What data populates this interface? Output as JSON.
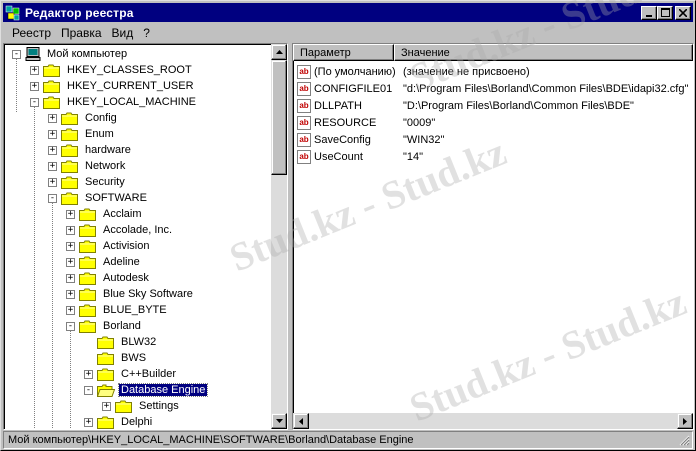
{
  "window": {
    "title": "Редактор реестра",
    "controls": [
      "minimize",
      "maximize",
      "close"
    ]
  },
  "menu": [
    {
      "label": "Реестр"
    },
    {
      "label": "Правка"
    },
    {
      "label": "Вид"
    },
    {
      "label": "?"
    }
  ],
  "tree": [
    {
      "label": "Мой компьютер",
      "level": 0,
      "type": "computer",
      "expander": "-"
    },
    {
      "label": "HKEY_CLASSES_ROOT",
      "level": 1,
      "type": "folder",
      "expander": "+"
    },
    {
      "label": "HKEY_CURRENT_USER",
      "level": 1,
      "type": "folder",
      "expander": "+"
    },
    {
      "label": "HKEY_LOCAL_MACHINE",
      "level": 1,
      "type": "folder",
      "expander": "-"
    },
    {
      "label": "Config",
      "level": 2,
      "type": "folder",
      "expander": "+"
    },
    {
      "label": "Enum",
      "level": 2,
      "type": "folder",
      "expander": "+"
    },
    {
      "label": "hardware",
      "level": 2,
      "type": "folder",
      "expander": "+"
    },
    {
      "label": "Network",
      "level": 2,
      "type": "folder",
      "expander": "+"
    },
    {
      "label": "Security",
      "level": 2,
      "type": "folder",
      "expander": "+"
    },
    {
      "label": "SOFTWARE",
      "level": 2,
      "type": "folder",
      "expander": "-"
    },
    {
      "label": "Acclaim",
      "level": 3,
      "type": "folder",
      "expander": "+"
    },
    {
      "label": "Accolade, Inc.",
      "level": 3,
      "type": "folder",
      "expander": "+"
    },
    {
      "label": "Activision",
      "level": 3,
      "type": "folder",
      "expander": "+"
    },
    {
      "label": "Adeline",
      "level": 3,
      "type": "folder",
      "expander": "+"
    },
    {
      "label": "Autodesk",
      "level": 3,
      "type": "folder",
      "expander": "+"
    },
    {
      "label": "Blue Sky Software",
      "level": 3,
      "type": "folder",
      "expander": "+"
    },
    {
      "label": "BLUE_BYTE",
      "level": 3,
      "type": "folder",
      "expander": "+"
    },
    {
      "label": "Borland",
      "level": 3,
      "type": "folder",
      "expander": "-"
    },
    {
      "label": "BLW32",
      "level": 4,
      "type": "folder",
      "expander": ""
    },
    {
      "label": "BWS",
      "level": 4,
      "type": "folder",
      "expander": ""
    },
    {
      "label": "C++Builder",
      "level": 4,
      "type": "folder",
      "expander": "+"
    },
    {
      "label": "Database Engine",
      "level": 4,
      "type": "folder-open",
      "expander": "-",
      "selected": true
    },
    {
      "label": "Settings",
      "level": 5,
      "type": "folder",
      "expander": "+"
    },
    {
      "label": "Delphi",
      "level": 4,
      "type": "folder",
      "expander": "+"
    }
  ],
  "list": {
    "columns": [
      "Параметр",
      "Значение"
    ],
    "rows": [
      {
        "name": "(По умолчанию)",
        "value": "(значение не присвоено)"
      },
      {
        "name": "CONFIGFILE01",
        "value": "\"d:\\Program Files\\Borland\\Common Files\\BDE\\idapi32.cfg\""
      },
      {
        "name": "DLLPATH",
        "value": "\"D:\\Program Files\\Borland\\Common Files\\BDE\""
      },
      {
        "name": "RESOURCE",
        "value": "\"0009\""
      },
      {
        "name": "SaveConfig",
        "value": "\"WIN32\""
      },
      {
        "name": "UseCount",
        "value": "\"14\""
      }
    ]
  },
  "status": {
    "path": "Мой компьютер\\HKEY_LOCAL_MACHINE\\SOFTWARE\\Borland\\Database Engine"
  },
  "watermark": "Stud.kz - Stud.kz",
  "colors": {
    "titlebar": "#000080",
    "selection": "#000080",
    "face": "#c0c0c0",
    "folder": "#ffff00",
    "string_icon": "#c00000"
  }
}
